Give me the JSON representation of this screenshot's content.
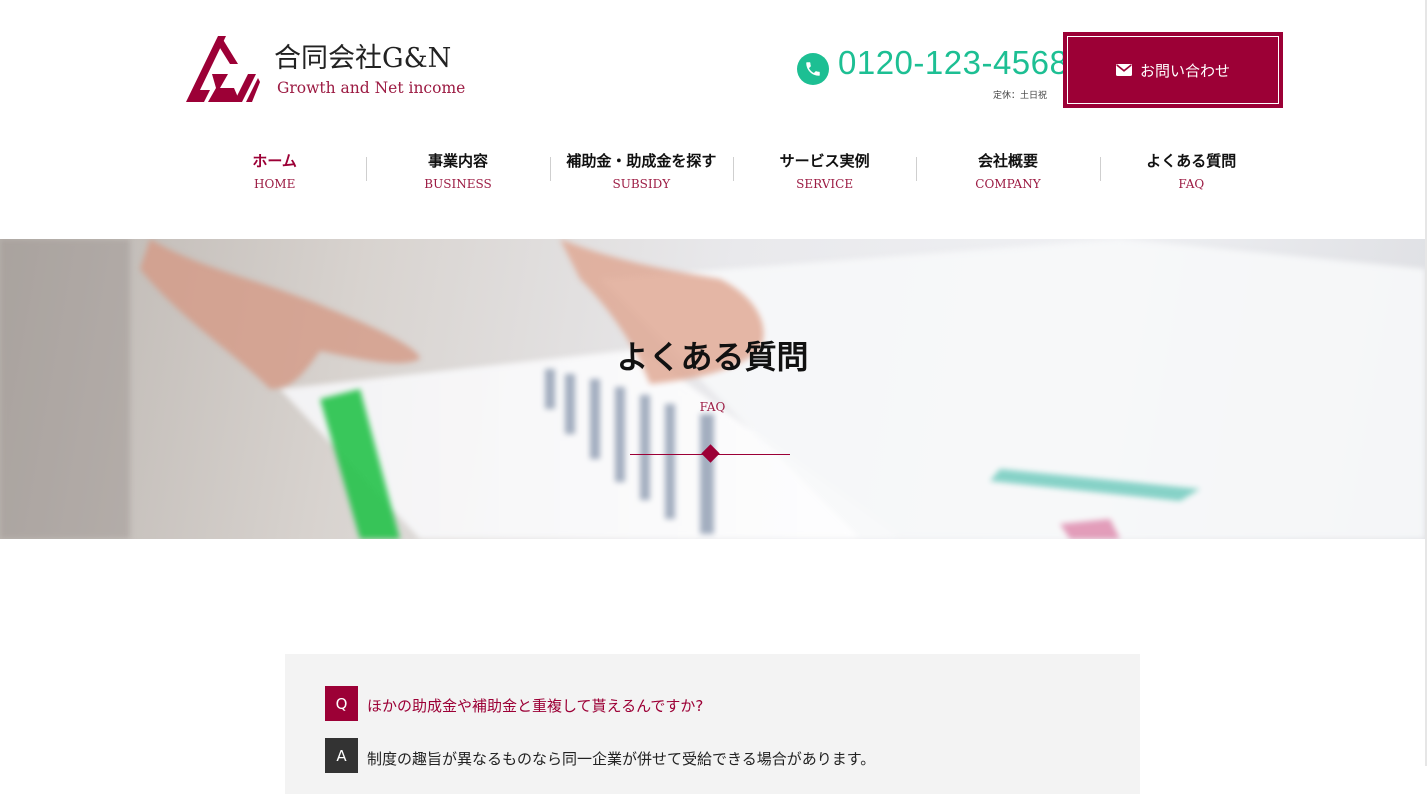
{
  "logo": {
    "name": "合同会社G&N",
    "tagline": "Growth and Net income"
  },
  "contact": {
    "phone_icon": "phone-icon",
    "phone": "0120-123-4568",
    "hours": "定休：土日祝",
    "button_icon": "envelope-icon",
    "button_label": "お問い合わせ"
  },
  "nav": {
    "items": [
      {
        "jp": "ホーム",
        "en": "HOME"
      },
      {
        "jp": "事業内容",
        "en": "BUSINESS"
      },
      {
        "jp": "補助金・助成金を探す",
        "en": "SUBSIDY"
      },
      {
        "jp": "サービス実例",
        "en": "SERVICE"
      },
      {
        "jp": "会社概要",
        "en": "COMPANY"
      },
      {
        "jp": "よくある質問",
        "en": "FAQ"
      }
    ],
    "active": "ホーム"
  },
  "hero": {
    "title": "よくある質問",
    "subtitle": "FAQ"
  },
  "faq": {
    "items": [
      {
        "q_badge": "Q",
        "question": "ほかの助成金や補助金と重複して貰えるんですか?",
        "a_badge": "A",
        "answer": "制度の趣旨が異なるものなら同一企業が併せて受給できる場合があります。"
      }
    ]
  },
  "colors": {
    "brand": "#9c0036",
    "phone": "#1dbf93"
  }
}
